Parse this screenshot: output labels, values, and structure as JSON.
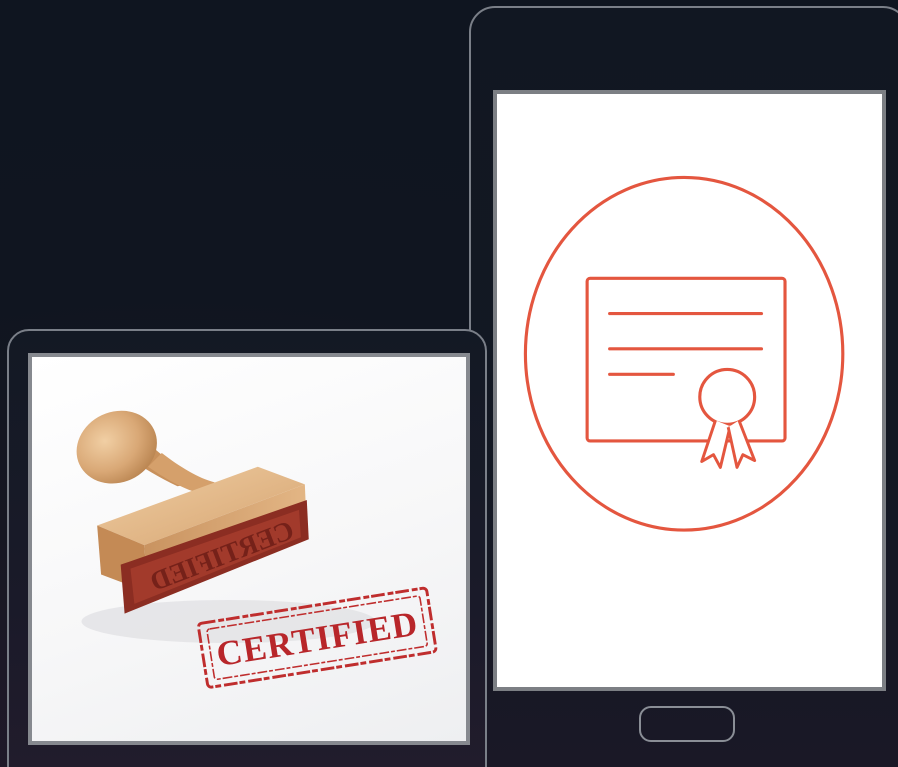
{
  "stamp_image": {
    "imprint_text": "CERTIFIED",
    "stamp_face_text": "CERTIFIED"
  },
  "colors": {
    "accent_line": "#e4563f",
    "stamp_red": "#b8262a",
    "wood": "#d9a876",
    "device_frame": "#7a7f88",
    "background": "#101520"
  },
  "icons": {
    "certificate": "certificate-icon",
    "stamp": "rubber-stamp"
  }
}
